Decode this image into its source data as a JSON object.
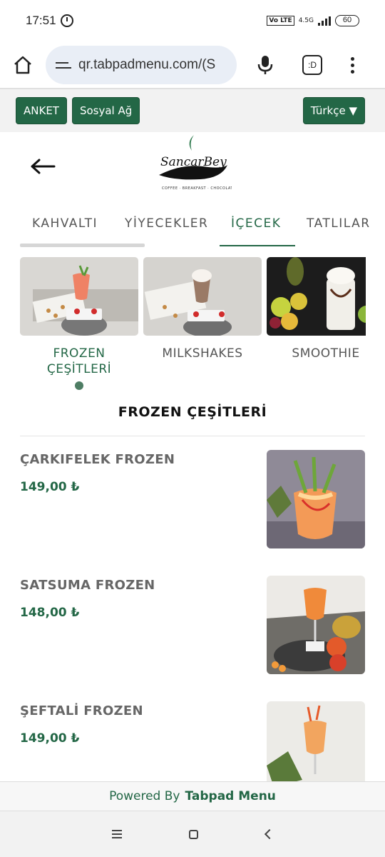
{
  "status_bar": {
    "time": "17:51",
    "network": "4.5G",
    "volte": "Vo LTE",
    "battery": "60"
  },
  "browser": {
    "url": "qr.tabpadmenu.com/(S",
    "tabs_label": ":D"
  },
  "actions": {
    "survey": "ANKET",
    "social": "Sosyal Ağ",
    "language": "Türkçe ▼"
  },
  "categories": [
    {
      "label": "KAHVALTI"
    },
    {
      "label": "YİYECEKLER"
    },
    {
      "label": "İÇECEK"
    },
    {
      "label": "TATLILAR"
    }
  ],
  "subcategories": [
    {
      "label": "FROZEN ÇEŞİTLERİ"
    },
    {
      "label": "MILKSHAKES"
    },
    {
      "label": "SMOOTHIE"
    }
  ],
  "section_title": "FROZEN ÇEŞİTLERİ",
  "products": [
    {
      "name": "ÇARKIFELEK FROZEN",
      "price": "149,00 ₺"
    },
    {
      "name": "SATSUMA FROZEN",
      "price": "148,00 ₺"
    },
    {
      "name": "ŞEFTALİ FROZEN",
      "price": "149,00 ₺"
    }
  ],
  "footer": {
    "powered": "Powered By",
    "brand": "Tabpad Menu"
  },
  "colors": {
    "accent": "#236746",
    "url_bg": "#e9eef6"
  }
}
